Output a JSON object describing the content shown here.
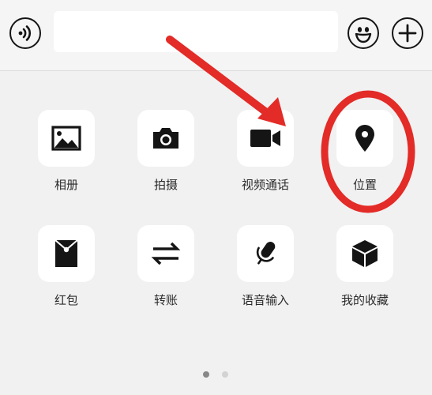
{
  "input_bar": {
    "voice_icon": "voice-wave-icon",
    "text_value": "",
    "emoji_icon": "smiley-icon",
    "plus_icon": "plus-icon"
  },
  "panel": {
    "items": [
      {
        "label": "相册",
        "icon": "photo-album-icon"
      },
      {
        "label": "拍摄",
        "icon": "camera-icon"
      },
      {
        "label": "视频通话",
        "icon": "video-camera-icon"
      },
      {
        "label": "位置",
        "icon": "location-pin-icon"
      },
      {
        "label": "红包",
        "icon": "red-envelope-icon"
      },
      {
        "label": "转账",
        "icon": "transfer-arrows-icon"
      },
      {
        "label": "语音输入",
        "icon": "microphone-icon"
      },
      {
        "label": "我的收藏",
        "icon": "favorites-cube-icon"
      }
    ]
  },
  "pager": {
    "total": 2,
    "current": 1
  },
  "annotation": {
    "color": "#e32b27"
  },
  "colors": {
    "background": "#f1f1f1",
    "tile": "#ffffff",
    "icon": "#151515",
    "dot_active": "#888888",
    "dot_inactive": "#d3d3d3"
  }
}
